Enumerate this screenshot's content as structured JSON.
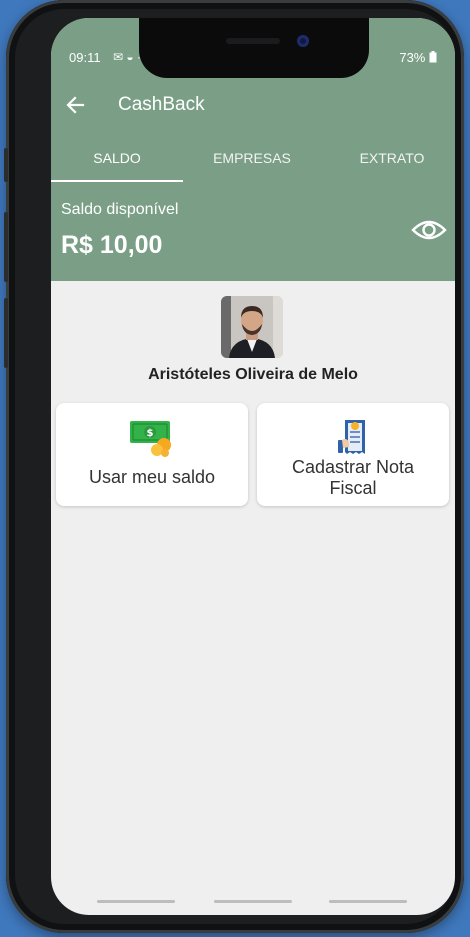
{
  "status_bar": {
    "time": "09:11",
    "icons": "✉ ◒ ·",
    "battery": "73%"
  },
  "app": {
    "title": "CashBack"
  },
  "tabs": [
    {
      "label": "SALDO",
      "active": true
    },
    {
      "label": "EMPRESAS",
      "active": false
    },
    {
      "label": "EXTRATO",
      "active": false
    }
  ],
  "balance": {
    "label": "Saldo disponível",
    "value": "R$ 10,00"
  },
  "user": {
    "name": "Aristóteles Oliveira de Melo"
  },
  "actions": {
    "use_balance": {
      "label": "Usar meu saldo",
      "icon": "money-icon"
    },
    "register_invoice": {
      "line1": "Cadastrar Nota",
      "line2": "Fiscal",
      "icon": "receipt-icon"
    }
  },
  "colors": {
    "header": "#7a9f86",
    "background": "#efefef",
    "frame": "#1c1e1f",
    "outer": "#3f78bd"
  }
}
